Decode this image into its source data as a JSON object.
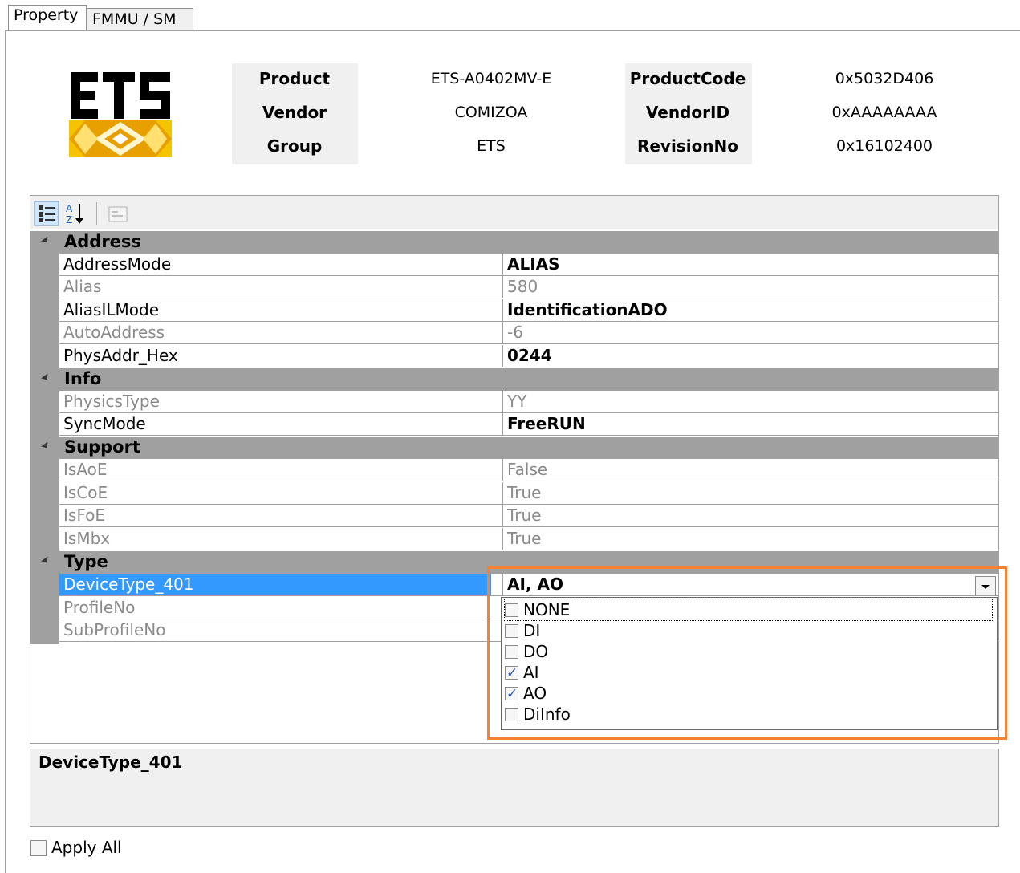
{
  "tabs": [
    {
      "label": "Property",
      "active": true
    },
    {
      "label": "FMMU / SM",
      "active": false
    }
  ],
  "logo": {
    "text": "ETS",
    "icon": "ets-logo-icon"
  },
  "header": {
    "product_label": "Product",
    "product_value": "ETS-A0402MV-E",
    "vendor_label": "Vendor",
    "vendor_value": "COMIZOA",
    "group_label": "Group",
    "group_value": "ETS",
    "productcode_label": "ProductCode",
    "productcode_value": "0x5032D406",
    "vendorid_label": "VendorID",
    "vendorid_value": "0xAAAAAAAA",
    "revision_label": "RevisionNo",
    "revision_value": "0x16102400"
  },
  "toolbar": {
    "categorized_icon": "categorized-icon",
    "alphabetical_icon": "sort-az-icon",
    "property_pages_icon": "property-pages-icon"
  },
  "grid": {
    "categories": {
      "address": "Address",
      "info": "Info",
      "support": "Support",
      "type": "Type"
    },
    "rows": {
      "addressmode": {
        "name": "AddressMode",
        "value": "ALIAS"
      },
      "alias": {
        "name": "Alias",
        "value": "580"
      },
      "aliasilmode": {
        "name": "AliasILMode",
        "value": "IdentificationADO"
      },
      "autoaddress": {
        "name": "AutoAddress",
        "value": "-6"
      },
      "physaddr": {
        "name": "PhysAddr_Hex",
        "value": "0244"
      },
      "physicstype": {
        "name": "PhysicsType",
        "value": "YY"
      },
      "syncmode": {
        "name": "SyncMode",
        "value": "FreeRUN"
      },
      "isaoe": {
        "name": "IsAoE",
        "value": "False"
      },
      "iscoe": {
        "name": "IsCoE",
        "value": "True"
      },
      "isfoe": {
        "name": "IsFoE",
        "value": "True"
      },
      "ismbx": {
        "name": "IsMbx",
        "value": "True"
      },
      "devicetype": {
        "name": "DeviceType_401",
        "value": "AI, AO"
      },
      "profileno": {
        "name": "ProfileNo",
        "value": ""
      },
      "subprofileno": {
        "name": "SubProfileNo",
        "value": ""
      }
    }
  },
  "dropdown": {
    "options": [
      {
        "label": "NONE",
        "checked": false
      },
      {
        "label": "DI",
        "checked": false
      },
      {
        "label": "DO",
        "checked": false
      },
      {
        "label": "AI",
        "checked": true
      },
      {
        "label": "AO",
        "checked": true
      },
      {
        "label": "DiInfo",
        "checked": false
      }
    ],
    "highlight_color": "#f58232"
  },
  "description": {
    "title": "DeviceType_401"
  },
  "apply_all": {
    "label": "Apply All",
    "checked": false
  },
  "colors": {
    "category_bg": "#a0a0a0",
    "selection": "#3399ff",
    "disabled_text": "#8a8a8a"
  }
}
